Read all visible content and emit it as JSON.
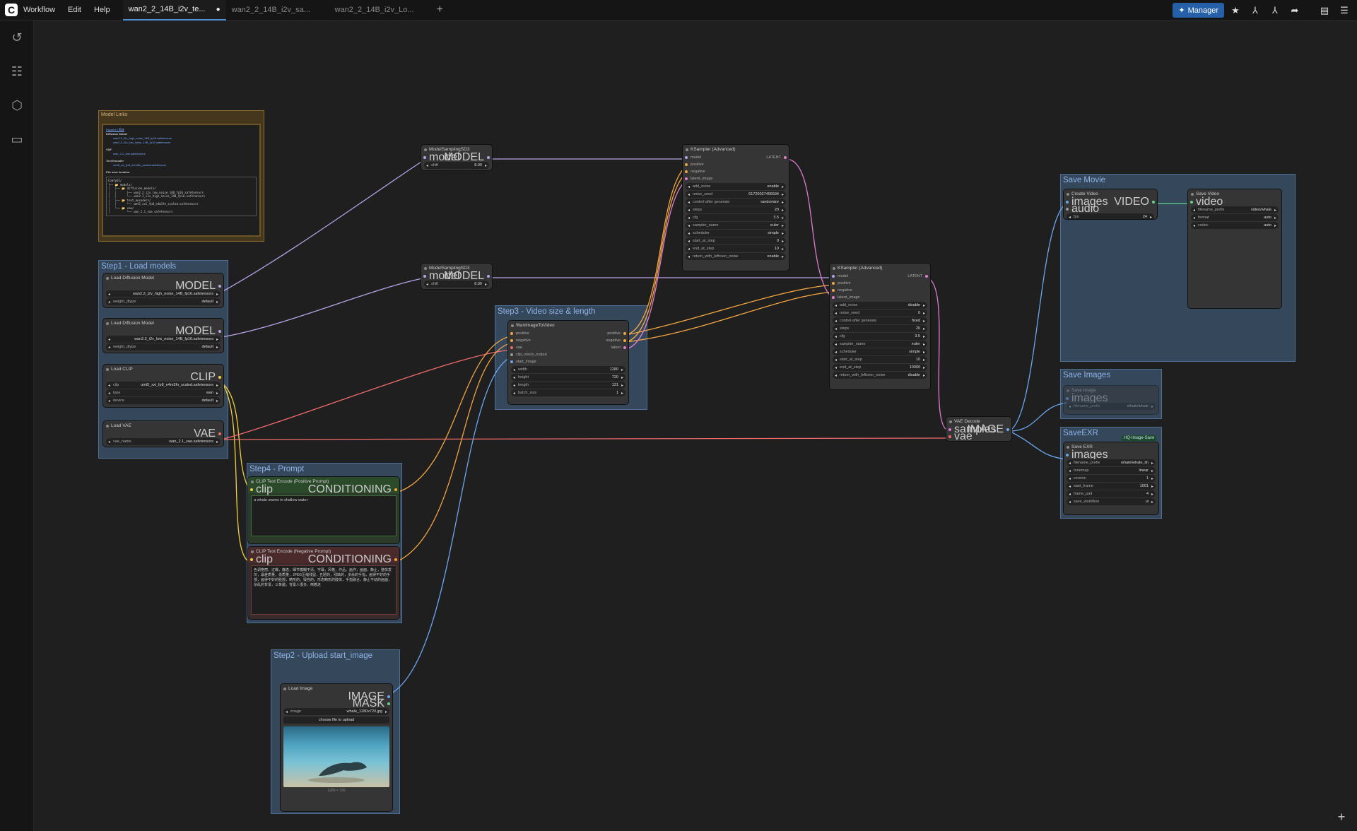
{
  "menu": [
    "Workflow",
    "Edit",
    "Help"
  ],
  "tabs": [
    {
      "label": "wan2_2_14B_i2v_te...",
      "modified": "●"
    },
    {
      "label": "wan2_2_14B_i2v_sa..."
    },
    {
      "label": "wan2_2_14B_i2v_Lo..."
    }
  ],
  "manager_label": "Manager",
  "groups": {
    "model_links": "Model Links",
    "step1": "Step1 - Load models",
    "step3": "Step3 - Video size & length",
    "step4": "Step4 - Prompt",
    "step2": "Step2 - Upload start_image",
    "save_movie": "Save Movie",
    "save_images": "Save Images",
    "save_exr": "SaveEXR"
  },
  "model_links": {
    "lang": "Español | 简体",
    "diffusion_title": "Diffusion Model",
    "diffusion_items": [
      "wan2.2_i2v_high_noise_14B_fp16.safetensors",
      "wan2.2_i2v_low_noise_14B_fp16.safetensors"
    ],
    "vae_title": "VAE",
    "vae_items": [
      "wan_2.1_vae.safetensors"
    ],
    "te_title": "Text Encoder",
    "te_items": [
      "umt5_xxl_fp8_e4m3fn_scaled.safetensors"
    ],
    "loc_title": "File save location",
    "tree": "ComfyUI/\n├── 📂 models/\n│   ├── 📂 diffusion_models/\n│   │      ├── wan2.2_i2v_low_noise_14B_fp16.safetensors\n│   │      └── wan2.2_i2v_high_noise_14B_fp16.safetensors\n│   ├── 📂 text_encoders/\n│   │      └── umt5_xxl_fp8_e4m3fn_scaled.safetensors\n│   └── 📂 vae/\n│          └── wan_2.1_vae.safetensors"
  },
  "load_diffusion_1": {
    "title": "Load Diffusion Model",
    "out": "MODEL",
    "unet": "wan2.2_i2v_high_noise_14B_fp16.safetensors",
    "dtype_label": "weight_dtype",
    "dtype": "default"
  },
  "load_diffusion_2": {
    "title": "Load Diffusion Model",
    "out": "MODEL",
    "unet": "wan2.2_i2v_low_noise_14B_fp16.safetensors",
    "dtype_label": "weight_dtype",
    "dtype": "default"
  },
  "load_clip": {
    "title": "Load CLIP",
    "out": "CLIP",
    "clip_label": "clip",
    "clip": "umt5_xxl_fp8_e4m3fn_scaled.safetensors",
    "type_label": "type",
    "type": "wan",
    "device_label": "device",
    "device": "default"
  },
  "load_vae": {
    "title": "Load VAE",
    "out": "VAE",
    "vae_label": "vae_name",
    "vae": "wan_2.1_vae.safetensors"
  },
  "msd1": {
    "title": "ModelSamplingSD3",
    "in": "model",
    "out": "MODEL",
    "shift_label": "shift",
    "shift": "8.00"
  },
  "msd2": {
    "title": "ModelSamplingSD3",
    "in": "model",
    "out": "MODEL",
    "shift_label": "shift",
    "shift": "8.00"
  },
  "wan_i2v": {
    "title": "WanImageToVideo",
    "inputs": [
      "positive",
      "negative",
      "vae",
      "clip_vision_output",
      "start_image"
    ],
    "outputs": [
      "positive",
      "negative",
      "latent"
    ],
    "widgets": [
      {
        "k": "width",
        "v": "1280"
      },
      {
        "k": "height",
        "v": "720"
      },
      {
        "k": "length",
        "v": "121"
      },
      {
        "k": "batch_size",
        "v": "1"
      }
    ]
  },
  "ks1": {
    "title": "KSampler (Advanced)",
    "inputs": [
      "model",
      "positive",
      "negative",
      "latent_image"
    ],
    "out": "LATENT",
    "widgets": [
      {
        "k": "add_noise",
        "v": "enable"
      },
      {
        "k": "noise_seed",
        "v": "617200374555​94"
      },
      {
        "k": "control after generate",
        "v": "randomize"
      },
      {
        "k": "steps",
        "v": "20"
      },
      {
        "k": "cfg",
        "v": "3.5"
      },
      {
        "k": "sampler_name",
        "v": "euler"
      },
      {
        "k": "scheduler",
        "v": "simple"
      },
      {
        "k": "start_at_step",
        "v": "0"
      },
      {
        "k": "end_at_step",
        "v": "10"
      },
      {
        "k": "return_with_leftover_noise",
        "v": "enable"
      }
    ]
  },
  "ks2": {
    "title": "KSampler (Advanced)",
    "inputs": [
      "model",
      "positive",
      "negative",
      "latent_image"
    ],
    "out": "LATENT",
    "widgets": [
      {
        "k": "add_noise",
        "v": "disable"
      },
      {
        "k": "noise_seed",
        "v": "0"
      },
      {
        "k": "control after generate",
        "v": "fixed"
      },
      {
        "k": "steps",
        "v": "20"
      },
      {
        "k": "cfg",
        "v": "3.5"
      },
      {
        "k": "sampler_name",
        "v": "euler"
      },
      {
        "k": "scheduler",
        "v": "simple"
      },
      {
        "k": "start_at_step",
        "v": "10"
      },
      {
        "k": "end_at_step",
        "v": "10000"
      },
      {
        "k": "return_with_leftover_noise",
        "v": "disable"
      }
    ]
  },
  "clip_pos": {
    "title": "CLIP Text Encode (Positive Prompt)",
    "in": "clip",
    "out": "CONDITIONING",
    "text": "a whale swims in shallow water"
  },
  "clip_neg": {
    "title": "CLIP Text Encode (Negative Prompt)",
    "in": "clip",
    "out": "CONDITIONING",
    "text": "色调艳丽，过曝，静态，细节模糊不清，字幕，风格，作品，画作，画面，静止，整体发灰，最差质量，低质量，JPEG压缩残留，丑陋的，残缺的，多余的手指，画得不好的手部，画得不好的脸部，畸形的，毁容的，形态畸形的肢体，手指融合，静止不动的画面，杂乱的背景，三条腿，背景人很多，倒着走"
  },
  "load_image": {
    "title": "Load Image",
    "outs": [
      "IMAGE",
      "MASK"
    ],
    "image_label": "image",
    "image": "whale_1280x720.jpg",
    "upload": "choose file to upload",
    "caption": "1280 × 720"
  },
  "vae_decode": {
    "title": "VAE Decode",
    "inputs": [
      "samples",
      "vae"
    ],
    "out": "IMAGE"
  },
  "create_video": {
    "title": "Create Video",
    "inputs": [
      "images",
      "audio"
    ],
    "out": "VIDEO",
    "fps_label": "fps",
    "fps": "24"
  },
  "save_video": {
    "title": "Save Video",
    "in": "video",
    "widgets": [
      {
        "k": "filename_prefix",
        "v": "video/whale"
      },
      {
        "k": "format",
        "v": "auto"
      },
      {
        "k": "codec",
        "v": "auto"
      }
    ]
  },
  "save_image": {
    "title": "Save Image",
    "in": "images",
    "prefix_label": "filename_prefix",
    "prefix": "whale/whale"
  },
  "save_exr": {
    "title": "Save EXR",
    "badge": "HQ-Image-Save",
    "in": "images",
    "widgets": [
      {
        "k": "filename_prefix",
        "v": "whale/whale_lin"
      },
      {
        "k": "tonemap",
        "v": "linear"
      },
      {
        "k": "version",
        "v": "1"
      },
      {
        "k": "start_frame",
        "v": "1001"
      },
      {
        "k": "frame_pad",
        "v": "4"
      },
      {
        "k": "save_workflow",
        "v": "ui"
      }
    ]
  },
  "colors": {
    "model": "#b6a3e8",
    "clip": "#f4d03f",
    "vae": "#f06b6b",
    "conditioning": "#f2a540",
    "latent": "#e07bd0",
    "image": "#6aa7f0",
    "video": "#6bd18a"
  }
}
